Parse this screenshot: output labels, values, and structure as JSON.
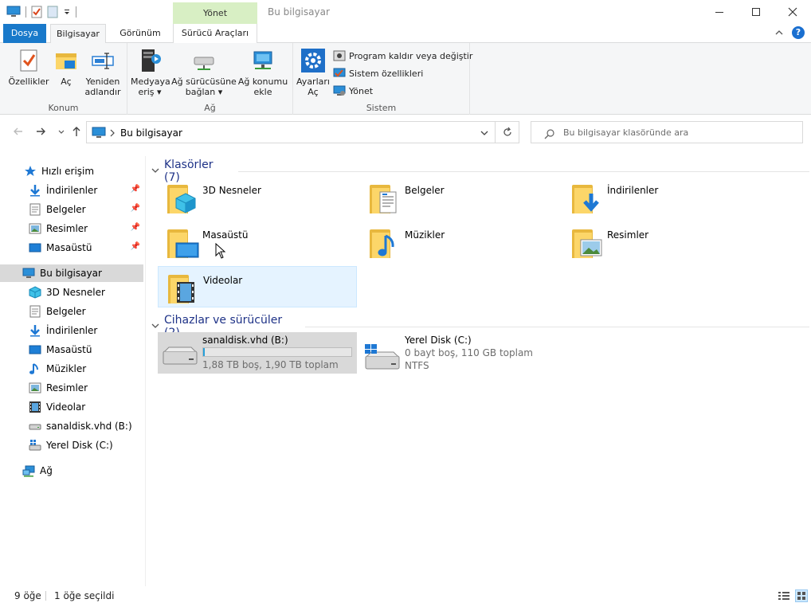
{
  "window": {
    "title": "Bu bilgisayar",
    "context_tab_header": "Yönet"
  },
  "tabs": {
    "file": "Dosya",
    "computer": "Bilgisayar",
    "view": "Görünüm",
    "drive_tools": "Sürücü Araçları"
  },
  "ribbon": {
    "location": {
      "label": "Konum",
      "properties": "Özellikler",
      "open": "Aç",
      "rename_1": "Yeniden",
      "rename_2": "adlandır"
    },
    "network": {
      "label": "Ağ",
      "media_1": "Medyaya",
      "media_2": "eriş",
      "map_1": "Ağ sürücüsüne",
      "map_2": "bağlan",
      "addloc_1": "Ağ konumu",
      "addloc_2": "ekle"
    },
    "system": {
      "label": "Sistem",
      "settings_1": "Ayarları",
      "settings_2": "Aç",
      "uninstall": "Program kaldır veya değiştir",
      "sysprops": "Sistem özellikleri",
      "manage": "Yönet"
    }
  },
  "address": {
    "path": "Bu bilgisayar",
    "search_placeholder": "Bu bilgisayar klasöründe ara"
  },
  "nav": {
    "quick_access": "Hızlı erişim",
    "qa_items": [
      "İndirilenler",
      "Belgeler",
      "Resimler",
      "Masaüstü"
    ],
    "this_pc": "Bu bilgisayar",
    "pc_items": [
      "3D Nesneler",
      "Belgeler",
      "İndirilenler",
      "Masaüstü",
      "Müzikler",
      "Resimler",
      "Videolar",
      "sanaldisk.vhd (B:)",
      "Yerel Disk (C:)"
    ],
    "network": "Ağ"
  },
  "folders": {
    "header": "Klasörler (7)",
    "items": [
      "3D Nesneler",
      "Belgeler",
      "İndirilenler",
      "Masaüstü",
      "Müzikler",
      "Resimler",
      "Videolar"
    ]
  },
  "drives": {
    "header": "Cihazlar ve sürücüler (2)",
    "items": [
      {
        "name": "sanaldisk.vhd (B:)",
        "detail": "1,88 TB boş, 1,90 TB toplam",
        "used_fraction": 0.011
      },
      {
        "name": "Yerel Disk (C:)",
        "detail": "0 bayt boş, 110 GB toplam",
        "fs": "NTFS"
      }
    ]
  },
  "status": {
    "count": "9 öğe",
    "selected": "1 öğe seçildi"
  },
  "colors": {
    "accent": "#1979ca",
    "context_tab": "#d8efc4",
    "selection": "#cce8ff",
    "folder": "#fcd669",
    "drive_bar": "#26a0da"
  }
}
